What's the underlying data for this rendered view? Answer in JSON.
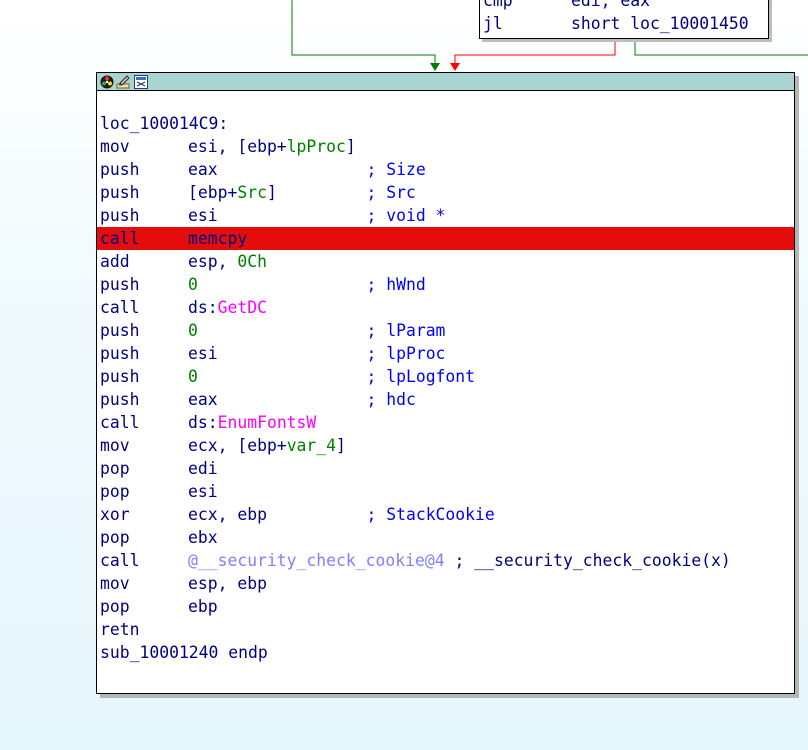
{
  "colors": {
    "node_header": "#a9d4d1",
    "highlight": "#e50c0c",
    "edge_true": "#008000",
    "edge_false": "#ff0000",
    "edge_plain": "#008000"
  },
  "header_icons": [
    "color-palette-icon",
    "edit-node-icon",
    "graph-view-icon"
  ],
  "prev_block": {
    "lines": [
      {
        "mnemonic": "cmp",
        "operands": "edi, eax"
      },
      {
        "mnemonic": "jl",
        "operands": "short loc_10001450"
      }
    ]
  },
  "block": {
    "label": "loc_100014C9:",
    "highlighted_index": 4,
    "lines": [
      {
        "mnemonic": "mov",
        "operands": [
          [
            "esi, [ebp+",
            "plain"
          ],
          [
            "lpProc",
            "green"
          ],
          [
            "]",
            "plain"
          ]
        ],
        "comment": ""
      },
      {
        "mnemonic": "push",
        "operands": [
          [
            "eax",
            "plain"
          ]
        ],
        "comment": "; Size"
      },
      {
        "mnemonic": "push",
        "operands": [
          [
            "[ebp+",
            "plain"
          ],
          [
            "Src",
            "green"
          ],
          [
            "]",
            "plain"
          ]
        ],
        "comment": "; Src"
      },
      {
        "mnemonic": "push",
        "operands": [
          [
            "esi",
            "plain"
          ]
        ],
        "comment": "; void *"
      },
      {
        "mnemonic": "call",
        "operands": [
          [
            "memcpy",
            "lbl"
          ]
        ],
        "comment": ""
      },
      {
        "mnemonic": "add",
        "operands": [
          [
            "esp, ",
            "plain"
          ],
          [
            "0Ch",
            "green"
          ]
        ],
        "comment": ""
      },
      {
        "mnemonic": "push",
        "operands": [
          [
            "0",
            "green"
          ]
        ],
        "comment": "; hWnd"
      },
      {
        "mnemonic": "call",
        "operands": [
          [
            "ds:",
            "plain"
          ],
          [
            "GetDC",
            "ext"
          ]
        ],
        "comment": ""
      },
      {
        "mnemonic": "push",
        "operands": [
          [
            "0",
            "green"
          ]
        ],
        "comment": "; lParam"
      },
      {
        "mnemonic": "push",
        "operands": [
          [
            "esi",
            "plain"
          ]
        ],
        "comment": "; lpProc"
      },
      {
        "mnemonic": "push",
        "operands": [
          [
            "0",
            "green"
          ]
        ],
        "comment": "; lpLogfont"
      },
      {
        "mnemonic": "push",
        "operands": [
          [
            "eax",
            "plain"
          ]
        ],
        "comment": "; hdc"
      },
      {
        "mnemonic": "call",
        "operands": [
          [
            "ds:",
            "plain"
          ],
          [
            "EnumFontsW",
            "ext"
          ]
        ],
        "comment": ""
      },
      {
        "mnemonic": "mov",
        "operands": [
          [
            "ecx, [ebp+",
            "plain"
          ],
          [
            "var_4",
            "green"
          ],
          [
            "]",
            "plain"
          ]
        ],
        "comment": ""
      },
      {
        "mnemonic": "pop",
        "operands": [
          [
            "edi",
            "plain"
          ]
        ],
        "comment": ""
      },
      {
        "mnemonic": "pop",
        "operands": [
          [
            "esi",
            "plain"
          ]
        ],
        "comment": ""
      },
      {
        "mnemonic": "xor",
        "operands": [
          [
            "ecx, ebp",
            "plain"
          ]
        ],
        "comment": "; StackCookie"
      },
      {
        "mnemonic": "pop",
        "operands": [
          [
            "ebx",
            "plain"
          ]
        ],
        "comment": ""
      },
      {
        "mnemonic": "call",
        "operands": [
          [
            "@__security_check_cookie@4",
            "lib"
          ]
        ],
        "comment": "; __security_check_cookie(x)",
        "comment_inline": true
      },
      {
        "mnemonic": "mov",
        "operands": [
          [
            "esp, ebp",
            "plain"
          ]
        ],
        "comment": ""
      },
      {
        "mnemonic": "pop",
        "operands": [
          [
            "ebp",
            "plain"
          ]
        ],
        "comment": ""
      },
      {
        "mnemonic": "retn",
        "operands": [],
        "comment": ""
      }
    ],
    "footer": "sub_10001240 endp"
  }
}
